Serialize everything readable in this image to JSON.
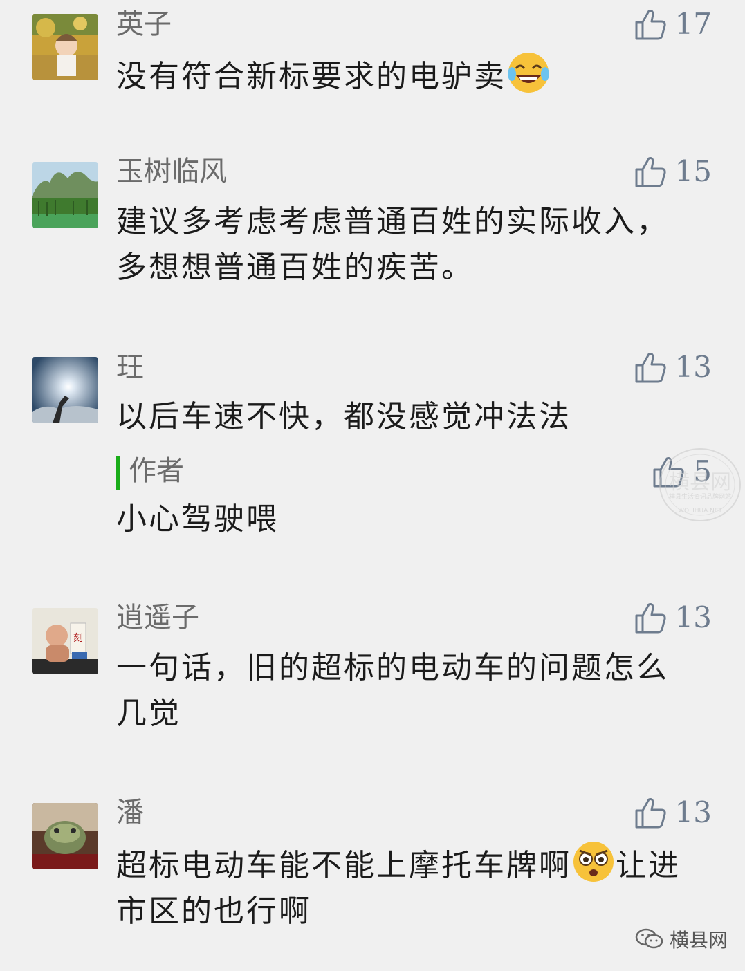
{
  "comments": [
    {
      "name": "英子",
      "likes": "17",
      "text": "没有符合新标要求的电驴卖",
      "emoji": "face-with-tears-of-joy"
    },
    {
      "name": "玉树临风",
      "likes": "15",
      "text_line1": "建议多考虑考虑普通百姓的实际收入，",
      "text_line2": "多想想普通百姓的疾苦。"
    },
    {
      "name": "玨",
      "likes": "13",
      "text": "以后车速不快，都没感觉冲法法",
      "reply": {
        "name": "作者",
        "likes": "5",
        "text": "小心驾驶喂"
      }
    },
    {
      "name": "逍遥子",
      "likes": "13",
      "text_line1": "一句话，旧的超标的电动车的问题怎么",
      "text_line2": "几觉"
    },
    {
      "name": "潘",
      "likes": "13",
      "text_line1_a": "超标电动车能不能上摩托车牌啊",
      "emoji": "flushed-angry-face",
      "text_line1_b": "让进",
      "text_line2": "市区的也行啊"
    }
  ],
  "watermark": {
    "seal_top": "横县网",
    "seal_mid": "横县生活资讯品牌网站",
    "seal_bottom": "WOLIHUA.NET",
    "brand": "横县网"
  },
  "icons": {
    "like": "thumbs-up-icon",
    "brand": "wechat-icon"
  }
}
